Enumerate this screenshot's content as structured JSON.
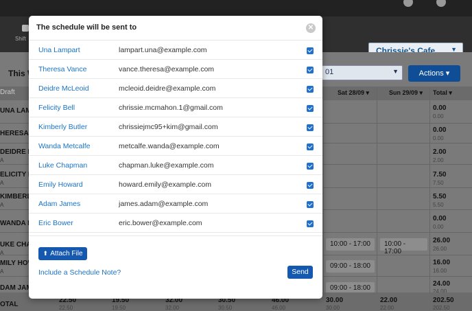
{
  "topbar": {
    "user_text": "...",
    "icon_a": "info-icon",
    "icon_b": "user-icon"
  },
  "navbar": {
    "shift_label": "Shift",
    "cafe_name": "Chrissie's Cafe",
    "cafe_caret": "▼"
  },
  "toolbar": {
    "week_label": "This W",
    "date_value": "01",
    "date_caret": "▼",
    "actions_label": "Actions ▾"
  },
  "grid": {
    "draft_label": "Draft",
    "headers": {
      "sat": "Sat 28/09 ▾",
      "sun": "Sun 29/09 ▾",
      "total": "Total ▾"
    },
    "rows": [
      {
        "name": "UNA LAMPA",
        "sub": "",
        "total": "0.00",
        "total_sub": "0.00"
      },
      {
        "name": "HERESA VA",
        "sub": "",
        "total": "0.00",
        "total_sub": "0.00"
      },
      {
        "name": "DEIDRE MC",
        "sub": "A",
        "total": "2.00",
        "total_sub": "2.00"
      },
      {
        "name": "ELICITY BE",
        "sub": "A",
        "total": "7.50",
        "total_sub": "7.50"
      },
      {
        "name": "KIMBERLY I",
        "sub": "A",
        "total": "5.50",
        "total_sub": "5.50"
      },
      {
        "name": "WANDA ME",
        "sub": "",
        "total": "0.00",
        "total_sub": "0.00"
      },
      {
        "name": "UKE CHAP",
        "sub": "A",
        "total": "26.00",
        "total_sub": "26.00"
      },
      {
        "name": "MILY HOW",
        "sub": "A",
        "total": "16.00",
        "total_sub": "16.00"
      },
      {
        "name": "DAM JAMI",
        "sub": "A",
        "total": "24.00",
        "total_sub": "24.00"
      }
    ],
    "shifts": [
      {
        "label": "10:00 - 17:00"
      },
      {
        "label": "10:00 - 17:00"
      },
      {
        "label": "09:00 - 18:00"
      },
      {
        "label": "09:00 - 18:00"
      }
    ],
    "footer": {
      "label": "OTAL",
      "values": [
        "22.50",
        "19.50",
        "32.00",
        "30.50",
        "46.00",
        "30.00",
        "22.00",
        "202.50"
      ],
      "subs": [
        "22.50",
        "19.50",
        "32.00",
        "30.50",
        "46.00",
        "30.00",
        "22.00",
        "202.50"
      ]
    }
  },
  "modal": {
    "title": "The schedule will be sent to",
    "close_glyph": "✕",
    "recipients": [
      {
        "name": "Una Lampart",
        "email": "lampart.una@example.com",
        "checked": true
      },
      {
        "name": "Theresa Vance",
        "email": "vance.theresa@example.com",
        "checked": true
      },
      {
        "name": "Deidre McLeoid",
        "email": "mcleoid.deidre@example.com",
        "checked": true
      },
      {
        "name": "Felicity Bell",
        "email": "chrissie.mcmahon.1@gmail.com",
        "checked": true
      },
      {
        "name": "Kimberly Butler",
        "email": "chrissiejmc95+kim@gmail.com",
        "checked": true
      },
      {
        "name": "Wanda Metcalfe",
        "email": "metcalfe.wanda@example.com",
        "checked": true
      },
      {
        "name": "Luke Chapman",
        "email": "chapman.luke@example.com",
        "checked": true
      },
      {
        "name": "Emily Howard",
        "email": "howard.emily@example.com",
        "checked": true
      },
      {
        "name": "Adam James",
        "email": "james.adam@example.com",
        "checked": true
      },
      {
        "name": "Eric Bower",
        "email": "eric.bower@example.com",
        "checked": true
      }
    ],
    "attach_label": "Attach File",
    "attach_icon": "upload-icon",
    "note_link": "Include a Schedule Note?",
    "send_label": "Send"
  },
  "colors": {
    "accent": "#1558b0",
    "link": "#1a73c4",
    "checkbox": "#1e6fd0"
  }
}
